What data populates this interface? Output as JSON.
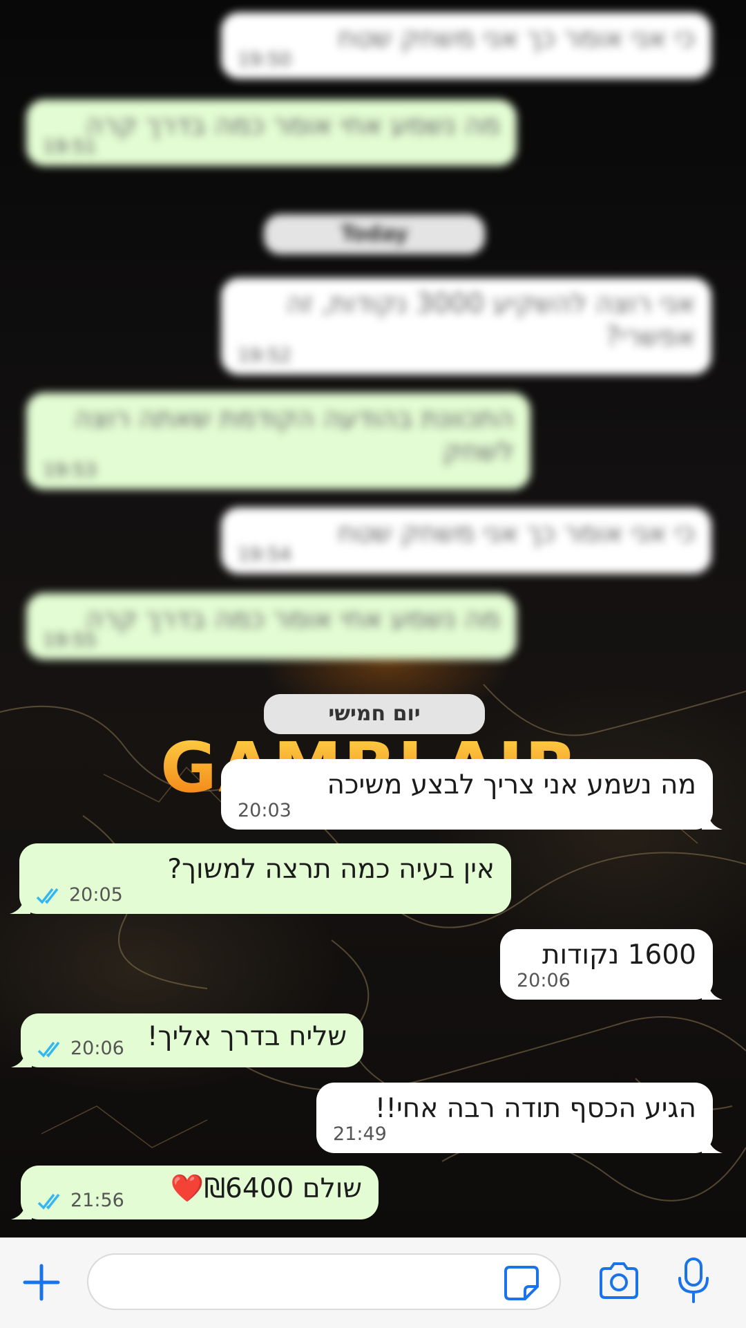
{
  "blurred": {
    "date_label": "Today",
    "messages": [
      {
        "dir": "in",
        "text": "כי אני אומר כך אני משחק שטח",
        "time": "19:50"
      },
      {
        "dir": "out",
        "text": "מה נשמע אחי אומר כמה בדרך קרה",
        "time": "19:51"
      },
      {
        "dir": "in",
        "text": "אני רוצה להשקיע 3000 נקודות, זה אפשרי?",
        "time": "19:52"
      },
      {
        "dir": "out",
        "text": "התכוונת בהודעה הקודמת שאתה רוצה לשחק",
        "time": "19:53"
      },
      {
        "dir": "in",
        "text": "כי אני אומר כך אני משחק שטח",
        "time": "19:54"
      },
      {
        "dir": "out",
        "text": "מה נשמע אחי אומר כמה בדרך קרה",
        "time": "19:55"
      }
    ]
  },
  "wallpaper_logo": "GAMBLAIR",
  "date_separator": "יום חמישי",
  "messages": [
    {
      "dir": "in",
      "text": "מה נשמע אני צריך לבצע משיכה",
      "time": "20:03"
    },
    {
      "dir": "out",
      "text": "אין בעיה כמה תרצה למשוך?",
      "time": "20:05",
      "status": "read-double-check-icon"
    },
    {
      "dir": "in",
      "text": "1600 נקודות",
      "time": "20:06"
    },
    {
      "dir": "out",
      "text": "שליח בדרך אליך!",
      "time": "20:06",
      "status": "read-double-check-icon"
    },
    {
      "dir": "in",
      "text": "הגיע הכסף תודה רבה אחי!!",
      "time": "21:49"
    },
    {
      "dir": "out",
      "text": "שולם ₪6400",
      "emoji": "❤️",
      "time": "21:56",
      "status": "read-double-check-icon"
    }
  ],
  "input_bar": {
    "icons": [
      "plus-icon",
      "sticker-icon",
      "camera-icon",
      "microphone-icon"
    ],
    "placeholder": ""
  },
  "colors": {
    "incoming": "#ffffff",
    "outgoing": "#e3fcd3",
    "accent": "#1a73e8",
    "read_check": "#34b7f1"
  }
}
